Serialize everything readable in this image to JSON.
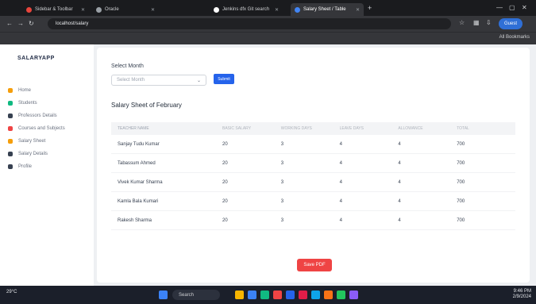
{
  "browser": {
    "tabs": [
      {
        "label": "Sidebar & Toolbar",
        "color": "#e8453c"
      },
      {
        "label": "Oracle",
        "color": "#9aa0a6"
      },
      {
        "label": "Jenkins dfx Git search",
        "color": "#ffffff"
      },
      {
        "label": "Salary Sheet / Table",
        "color": "#4285f4"
      }
    ],
    "address": "localhost/salary",
    "profile_label": "Guest",
    "bookmarks_right": "All Bookmarks"
  },
  "sidebar": {
    "logo": "SALARYAPP",
    "items": [
      {
        "label": "Home",
        "color": "#f59e0b"
      },
      {
        "label": "Students",
        "color": "#10b981"
      },
      {
        "label": "Professors Details",
        "color": "#374151"
      },
      {
        "label": "Courses and Subjects",
        "color": "#ef4444"
      },
      {
        "label": "Salary Sheet",
        "color": "#f59e0b"
      },
      {
        "label": "Salary Details",
        "color": "#374151"
      },
      {
        "label": "Profile",
        "color": "#374151"
      }
    ]
  },
  "form": {
    "month_label": "Select Month",
    "month_placeholder": "Select Month",
    "submit_label": "Submit"
  },
  "section_title": "Salary Sheet of February",
  "table": {
    "headers": [
      "Teacher Name",
      "Basic Salary",
      "Working Days",
      "Leave Days",
      "Allowance",
      "Total"
    ],
    "rows": [
      [
        "Sanjay Tudu Kumar",
        "20",
        "3",
        "4",
        "4",
        "700"
      ],
      [
        "Tabassum Ahmed",
        "20",
        "3",
        "4",
        "4",
        "700"
      ],
      [
        "Vivek Kumar Sharma",
        "20",
        "3",
        "4",
        "4",
        "700"
      ],
      [
        "Kamla Bala Kumari",
        "20",
        "3",
        "4",
        "4",
        "700"
      ],
      [
        "Rakesh Sharma",
        "20",
        "3",
        "4",
        "4",
        "700"
      ]
    ]
  },
  "save_label": "Save PDF",
  "taskbar": {
    "weather": "29°C",
    "search_label": "Search",
    "apps": [
      "#f7b500",
      "#3b82f6",
      "#10b981",
      "#ef4444",
      "#2563eb",
      "#e11d48",
      "#0ea5e9",
      "#f97316",
      "#22c55e",
      "#8b5cf6"
    ],
    "time": "9:46 PM",
    "date": "2/9/2024"
  }
}
